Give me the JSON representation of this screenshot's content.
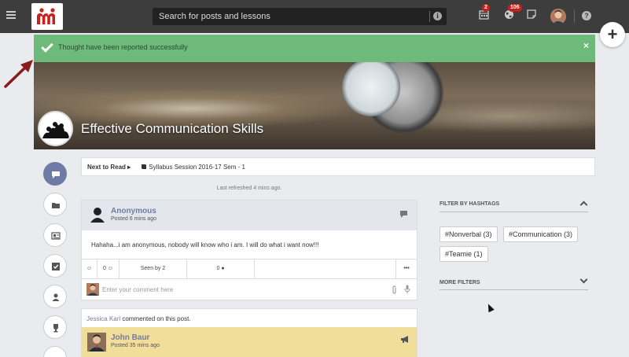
{
  "topbar": {
    "search_placeholder": "Search for posts and lessons",
    "calendar_badge": "2",
    "globe_badge": "106"
  },
  "alert": {
    "message": "Thought have been reported successfully",
    "close_glyph": "×"
  },
  "course": {
    "title": "Effective Communication Skills"
  },
  "next_to_read": {
    "label": "Next to Read",
    "lesson": "Syllabus Session 2016-17 Sem - 1"
  },
  "feed": {
    "last_refreshed": "Last refreshed 4 mins ago."
  },
  "post": {
    "author": "Anonymous",
    "time": "Posted 6 mins ago",
    "body": "Hahaha...i am anonymous, nobody will know who i am. I will do what i want now!!!",
    "likes": "0",
    "seen": "Seen by 2",
    "comments": "0",
    "more": "•••",
    "comment_placeholder": "Enter your comment here"
  },
  "post2": {
    "commenter": "Jessica Karl",
    "activity": "commented on this post.",
    "author": "John Baur",
    "time": "Posted 35 mins ago"
  },
  "filters": {
    "hashtags_title": "FILTER BY HASHTAGS",
    "tags": [
      "#Nonverbal (3)",
      "#Communication (3)",
      "#Teamie (1)"
    ],
    "more_title": "MORE FILTERS"
  },
  "colors": {
    "accent": "#6f7ba4",
    "success": "#6dba7a",
    "topbar": "#3d3d3d",
    "highlight": "#f2de9b",
    "badge": "#c8211c"
  }
}
